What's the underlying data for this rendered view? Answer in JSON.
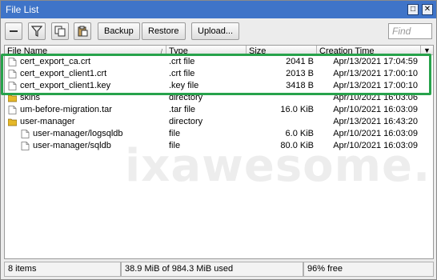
{
  "window": {
    "title": "File List",
    "restore_glyph": "□",
    "close_glyph": "✕"
  },
  "toolbar": {
    "remove_icon": "minus-icon",
    "filter_icon": "filter-icon",
    "copy_icon": "copy-icon",
    "paste_icon": "paste-icon",
    "backup_label": "Backup",
    "restore_label": "Restore",
    "upload_label": "Upload...",
    "find_placeholder": "Find"
  },
  "table": {
    "columns": [
      "File Name",
      "Type",
      "Size",
      "Creation Time"
    ],
    "sort_indicator": "/",
    "menu_glyph": "▼",
    "rows": [
      {
        "name": "cert_export_ca.crt",
        "type": ".crt file",
        "size": "2041 B",
        "time": "Apr/13/2021 17:04:59",
        "icon": "file-icon",
        "indent": false
      },
      {
        "name": "cert_export_client1.crt",
        "type": ".crt file",
        "size": "2013 B",
        "time": "Apr/13/2021 17:00:10",
        "icon": "file-icon",
        "indent": false
      },
      {
        "name": "cert_export_client1.key",
        "type": ".key file",
        "size": "3418 B",
        "time": "Apr/13/2021 17:00:10",
        "icon": "file-icon",
        "indent": false
      },
      {
        "name": "skins",
        "type": "directory",
        "size": "",
        "time": "Apr/10/2021 16:03:06",
        "icon": "folder-icon",
        "indent": false
      },
      {
        "name": "um-before-migration.tar",
        "type": ".tar file",
        "size": "16.0 KiB",
        "time": "Apr/10/2021 16:03:09",
        "icon": "file-icon",
        "indent": false
      },
      {
        "name": "user-manager",
        "type": "directory",
        "size": "",
        "time": "Apr/13/2021 16:43:20",
        "icon": "folder-icon",
        "indent": false
      },
      {
        "name": "user-manager/logsqldb",
        "type": "file",
        "size": "6.0 KiB",
        "time": "Apr/10/2021 16:03:09",
        "icon": "file-icon",
        "indent": true
      },
      {
        "name": "user-manager/sqldb",
        "type": "file",
        "size": "80.0 KiB",
        "time": "Apr/10/2021 16:03:09",
        "icon": "file-icon",
        "indent": true
      }
    ]
  },
  "watermark": "ixawesome.",
  "status": {
    "items": "8 items",
    "usage": "38.9 MiB of 984.3 MiB used",
    "free": "96% free"
  },
  "colors": {
    "titlebar": "#3f74c8",
    "highlight_border": "#27a24b",
    "folder": "#e5b829"
  }
}
